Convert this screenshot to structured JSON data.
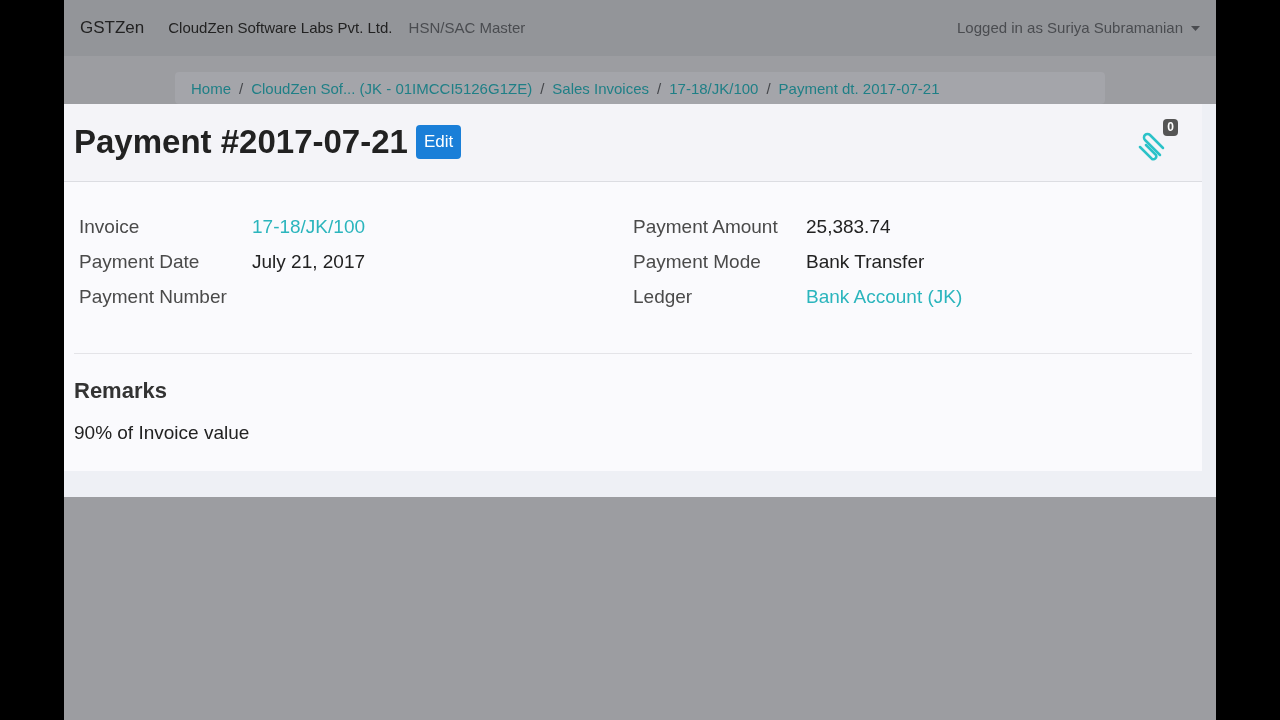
{
  "navbar": {
    "brand": "GSTZen",
    "company": "CloudZen Software Labs Pvt. Ltd.",
    "links": [
      "HSN/SAC Master"
    ],
    "user": "Logged in as Suriya Subramanian"
  },
  "breadcrumb": [
    "Home",
    "CloudZen Sof... (JK - 01IMCCI5126G1ZE)",
    "Sales Invoices",
    "17-18/JK/100",
    "Payment dt. 2017-07-21"
  ],
  "separator": "/",
  "header": {
    "title": "Payment #2017-07-21",
    "edit_button": "Edit",
    "attachments_count": "0"
  },
  "fields_left": [
    {
      "label": "Invoice",
      "value": "17-18/JK/100",
      "kind": "link"
    },
    {
      "label": "Payment Date",
      "value": "July 21, 2017",
      "kind": "text"
    },
    {
      "label": "Payment Number"
    }
  ],
  "fields_right": [
    {
      "label": "Payment Amount",
      "value": "25,383.74",
      "kind": "text"
    },
    {
      "label": "Payment Mode",
      "value": "Bank Transfer",
      "kind": "text"
    },
    {
      "label": "Ledger",
      "value": "Bank Account (JK)",
      "kind": "link"
    }
  ],
  "remarks": {
    "heading": "Remarks",
    "text": "90% of Invoice value"
  }
}
